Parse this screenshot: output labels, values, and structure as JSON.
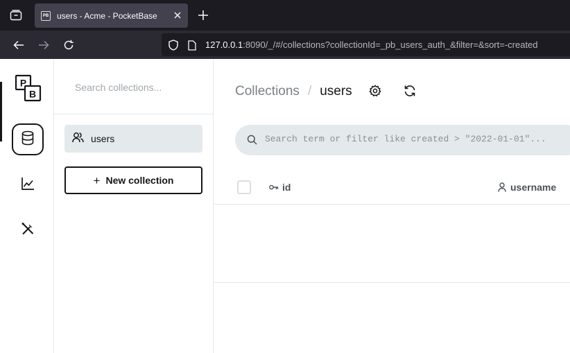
{
  "browser": {
    "tab": {
      "title": "users - Acme - PocketBase",
      "favicon_text": "PB"
    },
    "url": {
      "host": "127.0.0.1",
      "rest": ":8090/_/#/collections?collectionId=_pb_users_auth_&filter=&sort=-created"
    },
    "colors": {
      "tabbar": "#1c1b22",
      "navbar": "#2b2a33",
      "active_tab": "#42414d"
    }
  },
  "rail": {
    "logo_letters": [
      "P",
      "B"
    ],
    "items": [
      {
        "name": "collections",
        "icon": "database-icon",
        "active": true
      },
      {
        "name": "logs",
        "icon": "chart-line-icon",
        "active": false
      },
      {
        "name": "settings",
        "icon": "tools-icon",
        "active": false
      }
    ]
  },
  "sidebar": {
    "search_placeholder": "Search collections...",
    "collections": [
      {
        "label": "users",
        "icon": "users-icon"
      }
    ],
    "new_collection": {
      "plus": "+",
      "label": "New collection"
    }
  },
  "main": {
    "breadcrumb": {
      "root": "Collections",
      "separator": "/",
      "current": "users"
    },
    "search_placeholder": "Search term or filter like created > \"2022-01-01\"...",
    "columns": [
      {
        "label": "id",
        "icon": "key-icon"
      },
      {
        "label": "username",
        "icon": "user-icon"
      }
    ]
  },
  "colors": {
    "accent": "#16161a",
    "muted_bg": "#e4e9ec",
    "border": "#e4e9ec"
  }
}
